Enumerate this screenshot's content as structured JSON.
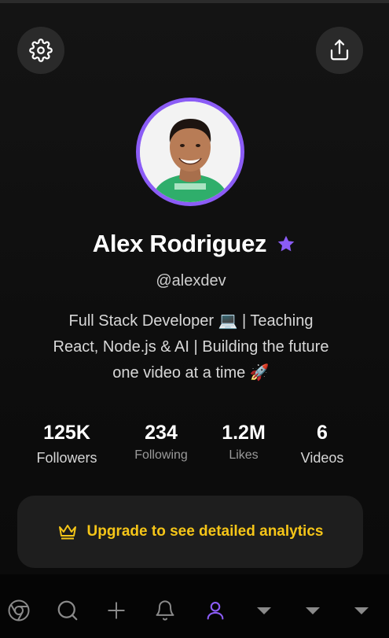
{
  "profile": {
    "name": "Alex Rodriguez",
    "handle": "@alexdev",
    "bio_line1": "Full Stack Developer 💻 | Teaching",
    "bio_line2": "React, Node.js & AI | Building the future",
    "bio_line3": "one video at a time 🚀",
    "verified_badge_icon": "star-icon",
    "avatar_ring_color": "#8b5cf6"
  },
  "stats": [
    {
      "value": "125K",
      "label": "Followers"
    },
    {
      "value": "234",
      "label": "Following"
    },
    {
      "value": "1.2M",
      "label": "Likes"
    },
    {
      "value": "6",
      "label": "Videos"
    }
  ],
  "upgrade": {
    "text": "Upgrade to see detailed analytics",
    "icon": "crown-icon",
    "color": "#f5c518"
  },
  "header": {
    "left_icon": "gear-icon",
    "right_icon": "share-icon"
  },
  "nav": {
    "active": "profile",
    "accent": "#8b5cf6",
    "items": [
      "browser-icon",
      "search-icon",
      "plus-icon",
      "bell-icon",
      "profile-icon",
      "chevron-down-icon",
      "chevron-down-icon",
      "chevron-down-icon"
    ]
  }
}
